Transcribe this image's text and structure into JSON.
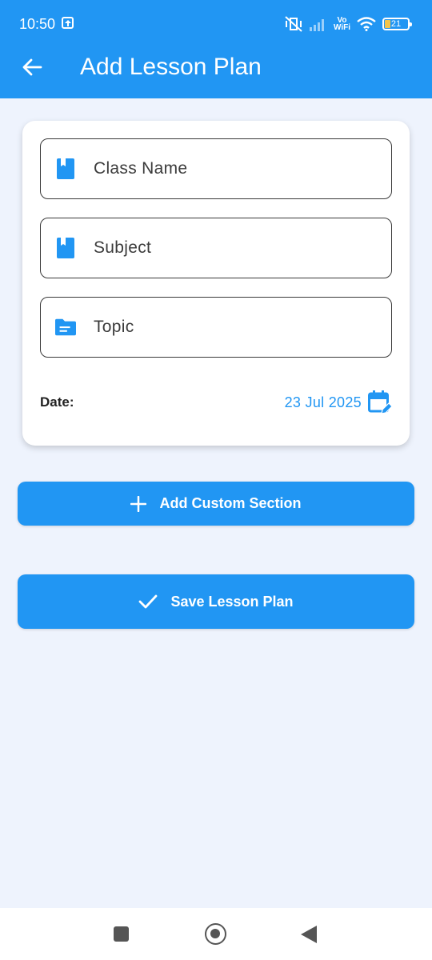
{
  "status_bar": {
    "time": "10:50",
    "vo_line1": "Vo",
    "vo_line2": "WiFi",
    "battery": "21"
  },
  "app_bar": {
    "title": "Add Lesson Plan",
    "color": "#2196f3"
  },
  "form": {
    "class_name": {
      "placeholder": "Class Name",
      "value": "",
      "icon": "book-icon"
    },
    "subject": {
      "placeholder": "Subject",
      "value": "",
      "icon": "book-icon"
    },
    "topic": {
      "placeholder": "Topic",
      "value": "",
      "icon": "folder-icon"
    },
    "date_label": "Date:",
    "date_value": "23 Jul 2025",
    "date_icon": "calendar-edit-icon"
  },
  "actions": {
    "add_section_label": "Add Custom Section",
    "save_label": "Save Lesson Plan"
  },
  "colors": {
    "primary": "#2196f3",
    "background": "#eef3fd"
  }
}
